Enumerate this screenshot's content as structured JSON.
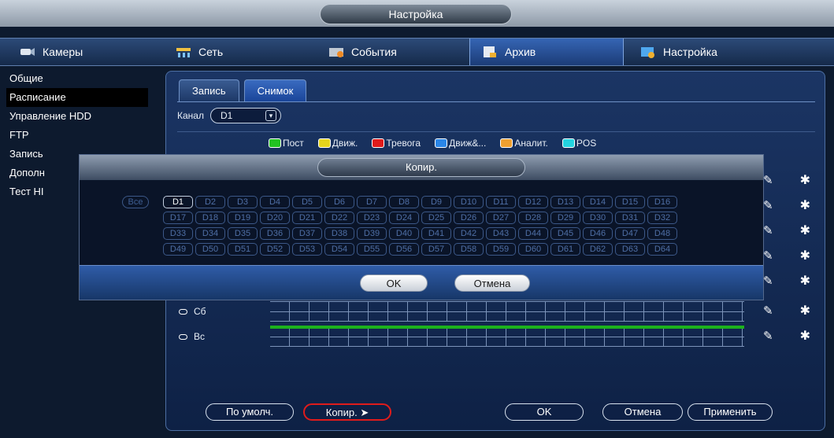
{
  "window": {
    "title": "Настройка"
  },
  "main_tabs": [
    {
      "label": "Камеры",
      "icon": "camera-icon"
    },
    {
      "label": "Сеть",
      "icon": "network-icon"
    },
    {
      "label": "События",
      "icon": "events-icon"
    },
    {
      "label": "Архив",
      "icon": "archive-icon",
      "active": true
    },
    {
      "label": "Настройка",
      "icon": "settings-icon"
    }
  ],
  "sidebar": {
    "items": [
      {
        "label": "Общие"
      },
      {
        "label": "Расписание",
        "active": true
      },
      {
        "label": "Управление HDD"
      },
      {
        "label": "FTP"
      },
      {
        "label": "Запись"
      },
      {
        "label": "Дополн"
      },
      {
        "label": "Тест HI"
      }
    ]
  },
  "subtabs": [
    {
      "label": "Запись"
    },
    {
      "label": "Снимок",
      "active": true
    }
  ],
  "channel": {
    "label": "Канал",
    "value": "D1"
  },
  "legend": [
    {
      "label": "Пост",
      "color": "#22c322"
    },
    {
      "label": "Движ.",
      "color": "#e6d51c"
    },
    {
      "label": "Тревога",
      "color": "#e01b1b"
    },
    {
      "label": "Движ&...",
      "color": "#2a86e8"
    },
    {
      "label": "Аналит.",
      "color": "#f0a030"
    },
    {
      "label": "POS",
      "color": "#23d4e0"
    }
  ],
  "days": [
    {
      "label": "Сб"
    },
    {
      "label": "Вс"
    }
  ],
  "buttons": {
    "default": "По умолч.",
    "copy": "Копир.",
    "ok": "OK",
    "cancel": "Отмена",
    "apply": "Применить"
  },
  "modal": {
    "title": "Копир.",
    "all": "Все",
    "channels": [
      "D1",
      "D2",
      "D3",
      "D4",
      "D5",
      "D6",
      "D7",
      "D8",
      "D9",
      "D10",
      "D11",
      "D12",
      "D13",
      "D14",
      "D15",
      "D16",
      "D17",
      "D18",
      "D19",
      "D20",
      "D21",
      "D22",
      "D23",
      "D24",
      "D25",
      "D26",
      "D27",
      "D28",
      "D29",
      "D30",
      "D31",
      "D32",
      "D33",
      "D34",
      "D35",
      "D36",
      "D37",
      "D38",
      "D39",
      "D40",
      "D41",
      "D42",
      "D43",
      "D44",
      "D45",
      "D46",
      "D47",
      "D48",
      "D49",
      "D50",
      "D51",
      "D52",
      "D53",
      "D54",
      "D55",
      "D56",
      "D57",
      "D58",
      "D59",
      "D60",
      "D61",
      "D62",
      "D63",
      "D64"
    ],
    "selected": "D1",
    "ok": "OK",
    "cancel": "Отмена"
  }
}
